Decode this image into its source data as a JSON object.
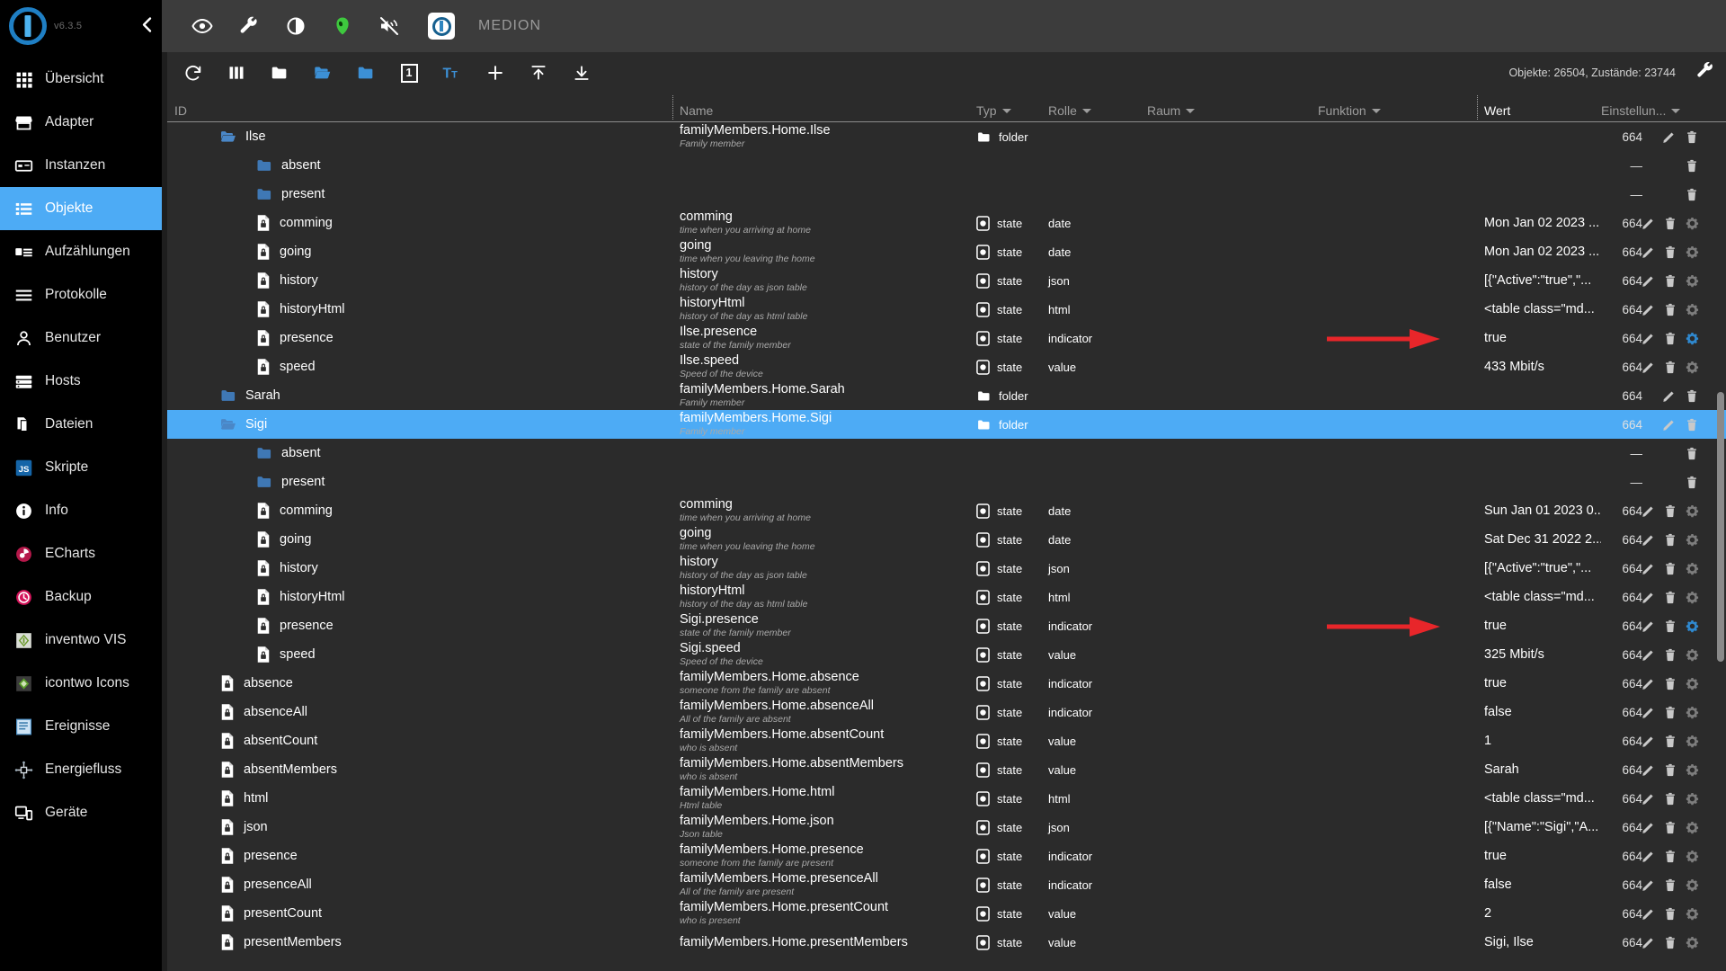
{
  "app": {
    "version": "v6.3.5",
    "host_name": "MEDION",
    "counts": "Objekte: 26504, Zustände: 23744"
  },
  "appbar": {
    "icons": [
      {
        "name": "eye-icon",
        "label": "Expertenmodus"
      },
      {
        "name": "wrench-icon",
        "label": "Einstellungen"
      },
      {
        "name": "contrast-icon",
        "label": "Design"
      },
      {
        "name": "alien-head-icon",
        "label": "Benutzer"
      },
      {
        "name": "no-sound-icon",
        "label": "Ton aus"
      }
    ]
  },
  "sidebar": {
    "collapse_icon": "chevron-left-icon",
    "items": [
      {
        "label": "Übersicht",
        "icon": "grid-icon",
        "active": false
      },
      {
        "label": "Adapter",
        "icon": "store-icon",
        "active": false
      },
      {
        "label": "Instanzen",
        "icon": "instances-icon",
        "active": false
      },
      {
        "label": "Objekte",
        "icon": "list-icon",
        "active": true
      },
      {
        "label": "Aufzählungen",
        "icon": "enum-icon",
        "active": false
      },
      {
        "label": "Protokolle",
        "icon": "log-icon",
        "active": false
      },
      {
        "label": "Benutzer",
        "icon": "user-icon",
        "active": false
      },
      {
        "label": "Hosts",
        "icon": "hosts-icon",
        "active": false
      },
      {
        "label": "Dateien",
        "icon": "files-icon",
        "active": false
      },
      {
        "label": "Skripte",
        "icon": "js-icon",
        "active": false
      },
      {
        "label": "Info",
        "icon": "info-icon",
        "active": false
      },
      {
        "label": "ECharts",
        "icon": "echarts-icon",
        "active": false
      },
      {
        "label": "Backup",
        "icon": "backup-icon",
        "active": false
      },
      {
        "label": "inventwo VIS",
        "icon": "inventwo-vis-icon",
        "active": false
      },
      {
        "label": "icontwo Icons",
        "icon": "icontwo-icons-icon",
        "active": false
      },
      {
        "label": "Ereignisse",
        "icon": "events-icon",
        "active": false
      },
      {
        "label": "Energiefluss",
        "icon": "energy-flow-icon",
        "active": false
      },
      {
        "label": "Geräte",
        "icon": "devices-icon",
        "active": false
      }
    ]
  },
  "toolbar": {
    "buttons": [
      {
        "name": "refresh-button",
        "label": "Aktualisieren"
      },
      {
        "name": "columns-button",
        "label": "Spalten"
      },
      {
        "name": "collapse-all-button",
        "label": "Alle einklappen"
      },
      {
        "name": "expand-all-button",
        "label": "Alle ausklappen"
      },
      {
        "name": "expand-folder-button",
        "label": "Ordner ausklappen"
      },
      {
        "name": "depth-button",
        "label": "1"
      },
      {
        "name": "text-size-button",
        "label": "Schriftgröße"
      },
      {
        "name": "add-object-button",
        "label": "Hinzufügen"
      },
      {
        "name": "import-button",
        "label": "Importieren"
      },
      {
        "name": "export-button",
        "label": "Exportieren"
      }
    ],
    "depth_badge": "1",
    "settings_label": "Einstellungen"
  },
  "table": {
    "columns": [
      {
        "key": "id",
        "label": "ID",
        "filter": false
      },
      {
        "key": "name",
        "label": "Name",
        "filter": false
      },
      {
        "key": "typ",
        "label": "Typ",
        "filter": true
      },
      {
        "key": "rolle",
        "label": "Rolle",
        "filter": true
      },
      {
        "key": "raum",
        "label": "Raum",
        "filter": true
      },
      {
        "key": "funktion",
        "label": "Funktion",
        "filter": true
      },
      {
        "key": "wert",
        "label": "Wert",
        "filter": false
      },
      {
        "key": "einstellungen",
        "label": "Einstellun...",
        "filter": true
      }
    ],
    "rows": [
      {
        "id": "Ilse",
        "indent": 1,
        "icon": "folder-open-icon",
        "name": "familyMembers.Home.Ilse",
        "desc": "Family member",
        "typ": "folder",
        "typ_icon": "folder-icon",
        "rolle": "",
        "wert": "",
        "perm": "664",
        "actions": [
          "edit",
          "delete"
        ],
        "selected": false
      },
      {
        "id": "absent",
        "indent": 2,
        "icon": "folder-icon",
        "name": "",
        "desc": "",
        "typ": "",
        "typ_icon": "",
        "rolle": "",
        "wert": "",
        "perm": "—",
        "actions": [
          "delete"
        ],
        "selected": false
      },
      {
        "id": "present",
        "indent": 2,
        "icon": "folder-icon",
        "name": "",
        "desc": "",
        "typ": "",
        "typ_icon": "",
        "rolle": "",
        "wert": "",
        "perm": "—",
        "actions": [
          "delete"
        ],
        "selected": false
      },
      {
        "id": "comming",
        "indent": 2,
        "icon": "state-doc-icon",
        "name": "comming",
        "desc": "time when you arriving at home",
        "typ": "state",
        "typ_icon": "state-icon",
        "rolle": "date",
        "wert": "Mon Jan 02 2023 ...",
        "perm": "664",
        "actions": [
          "edit",
          "delete",
          "settings"
        ],
        "selected": false
      },
      {
        "id": "going",
        "indent": 2,
        "icon": "state-doc-icon",
        "name": "going",
        "desc": "time when you leaving the home",
        "typ": "state",
        "typ_icon": "state-icon",
        "rolle": "date",
        "wert": "Mon Jan 02 2023 ...",
        "perm": "664",
        "actions": [
          "edit",
          "delete",
          "settings"
        ],
        "selected": false
      },
      {
        "id": "history",
        "indent": 2,
        "icon": "state-doc-icon",
        "name": "history",
        "desc": "history of the day as json table",
        "typ": "state",
        "typ_icon": "state-icon",
        "rolle": "json",
        "wert": "[{\"Active\":\"true\",\"...",
        "perm": "664",
        "actions": [
          "edit",
          "delete",
          "settings"
        ],
        "selected": false
      },
      {
        "id": "historyHtml",
        "indent": 2,
        "icon": "state-doc-icon",
        "name": "historyHtml",
        "desc": "history of the day as html table",
        "typ": "state",
        "typ_icon": "state-icon",
        "rolle": "html",
        "wert": "<table class=\"md...",
        "perm": "664",
        "actions": [
          "edit",
          "delete",
          "settings"
        ],
        "selected": false
      },
      {
        "id": "presence",
        "indent": 2,
        "icon": "state-doc-icon",
        "name": "Ilse.presence",
        "desc": "state of the family member",
        "typ": "state",
        "typ_icon": "state-icon",
        "rolle": "indicator",
        "wert": "true",
        "perm": "664",
        "actions": [
          "edit",
          "delete",
          "settings-active"
        ],
        "selected": false,
        "arrow": true
      },
      {
        "id": "speed",
        "indent": 2,
        "icon": "state-doc-icon",
        "name": "Ilse.speed",
        "desc": "Speed of the device",
        "typ": "state",
        "typ_icon": "state-icon",
        "rolle": "value",
        "wert": "433 Mbit/s",
        "perm": "664",
        "actions": [
          "edit",
          "delete",
          "settings"
        ],
        "selected": false
      },
      {
        "id": "Sarah",
        "indent": 1,
        "icon": "folder-icon",
        "name": "familyMembers.Home.Sarah",
        "desc": "Family member",
        "typ": "folder",
        "typ_icon": "folder-icon",
        "rolle": "",
        "wert": "",
        "perm": "664",
        "actions": [
          "edit",
          "delete"
        ],
        "selected": false
      },
      {
        "id": "Sigi",
        "indent": 1,
        "icon": "folder-open-icon",
        "name": "familyMembers.Home.Sigi",
        "desc": "Family member",
        "typ": "folder",
        "typ_icon": "folder-icon",
        "rolle": "",
        "wert": "",
        "perm": "664",
        "actions": [
          "edit",
          "delete"
        ],
        "selected": true
      },
      {
        "id": "absent",
        "indent": 2,
        "icon": "folder-icon",
        "name": "",
        "desc": "",
        "typ": "",
        "typ_icon": "",
        "rolle": "",
        "wert": "",
        "perm": "—",
        "actions": [
          "delete"
        ],
        "selected": false
      },
      {
        "id": "present",
        "indent": 2,
        "icon": "folder-icon",
        "name": "",
        "desc": "",
        "typ": "",
        "typ_icon": "",
        "rolle": "",
        "wert": "",
        "perm": "—",
        "actions": [
          "delete"
        ],
        "selected": false
      },
      {
        "id": "comming",
        "indent": 2,
        "icon": "state-doc-icon",
        "name": "comming",
        "desc": "time when you arriving at home",
        "typ": "state",
        "typ_icon": "state-icon",
        "rolle": "date",
        "wert": "Sun Jan 01 2023 0...",
        "perm": "664",
        "actions": [
          "edit",
          "delete",
          "settings"
        ],
        "selected": false
      },
      {
        "id": "going",
        "indent": 2,
        "icon": "state-doc-icon",
        "name": "going",
        "desc": "time when you leaving the home",
        "typ": "state",
        "typ_icon": "state-icon",
        "rolle": "date",
        "wert": "Sat Dec 31 2022 2...",
        "perm": "664",
        "actions": [
          "edit",
          "delete",
          "settings"
        ],
        "selected": false
      },
      {
        "id": "history",
        "indent": 2,
        "icon": "state-doc-icon",
        "name": "history",
        "desc": "history of the day as json table",
        "typ": "state",
        "typ_icon": "state-icon",
        "rolle": "json",
        "wert": "[{\"Active\":\"true\",\"...",
        "perm": "664",
        "actions": [
          "edit",
          "delete",
          "settings"
        ],
        "selected": false
      },
      {
        "id": "historyHtml",
        "indent": 2,
        "icon": "state-doc-icon",
        "name": "historyHtml",
        "desc": "history of the day as html table",
        "typ": "state",
        "typ_icon": "state-icon",
        "rolle": "html",
        "wert": "<table class=\"md...",
        "perm": "664",
        "actions": [
          "edit",
          "delete",
          "settings"
        ],
        "selected": false
      },
      {
        "id": "presence",
        "indent": 2,
        "icon": "state-doc-icon",
        "name": "Sigi.presence",
        "desc": "state of the family member",
        "typ": "state",
        "typ_icon": "state-icon",
        "rolle": "indicator",
        "wert": "true",
        "perm": "664",
        "actions": [
          "edit",
          "delete",
          "settings-active"
        ],
        "selected": false,
        "arrow": true
      },
      {
        "id": "speed",
        "indent": 2,
        "icon": "state-doc-icon",
        "name": "Sigi.speed",
        "desc": "Speed of the device",
        "typ": "state",
        "typ_icon": "state-icon",
        "rolle": "value",
        "wert": "325 Mbit/s",
        "perm": "664",
        "actions": [
          "edit",
          "delete",
          "settings"
        ],
        "selected": false
      },
      {
        "id": "absence",
        "indent": 1,
        "icon": "state-doc-icon",
        "name": "familyMembers.Home.absence",
        "desc": "someone from the family are absent",
        "typ": "state",
        "typ_icon": "state-icon",
        "rolle": "indicator",
        "wert": "true",
        "perm": "664",
        "actions": [
          "edit",
          "delete",
          "settings"
        ],
        "selected": false
      },
      {
        "id": "absenceAll",
        "indent": 1,
        "icon": "state-doc-icon",
        "name": "familyMembers.Home.absenceAll",
        "desc": "All of the family are absent",
        "typ": "state",
        "typ_icon": "state-icon",
        "rolle": "indicator",
        "wert": "false",
        "perm": "664",
        "actions": [
          "edit",
          "delete",
          "settings"
        ],
        "selected": false
      },
      {
        "id": "absentCount",
        "indent": 1,
        "icon": "state-doc-icon",
        "name": "familyMembers.Home.absentCount",
        "desc": "who is absent",
        "typ": "state",
        "typ_icon": "state-icon",
        "rolle": "value",
        "wert": "1",
        "perm": "664",
        "actions": [
          "edit",
          "delete",
          "settings"
        ],
        "selected": false
      },
      {
        "id": "absentMembers",
        "indent": 1,
        "icon": "state-doc-icon",
        "name": "familyMembers.Home.absentMembers",
        "desc": "who is absent",
        "typ": "state",
        "typ_icon": "state-icon",
        "rolle": "value",
        "wert": "Sarah",
        "perm": "664",
        "actions": [
          "edit",
          "delete",
          "settings"
        ],
        "selected": false
      },
      {
        "id": "html",
        "indent": 1,
        "icon": "state-doc-icon",
        "name": "familyMembers.Home.html",
        "desc": "Html table",
        "typ": "state",
        "typ_icon": "state-icon",
        "rolle": "html",
        "wert": "<table class=\"md...",
        "perm": "664",
        "actions": [
          "edit",
          "delete",
          "settings"
        ],
        "selected": false
      },
      {
        "id": "json",
        "indent": 1,
        "icon": "state-doc-icon",
        "name": "familyMembers.Home.json",
        "desc": "Json table",
        "typ": "state",
        "typ_icon": "state-icon",
        "rolle": "json",
        "wert": "[{\"Name\":\"Sigi\",\"A...",
        "perm": "664",
        "actions": [
          "edit",
          "delete",
          "settings"
        ],
        "selected": false
      },
      {
        "id": "presence",
        "indent": 1,
        "icon": "state-doc-icon",
        "name": "familyMembers.Home.presence",
        "desc": "someone from the family are present",
        "typ": "state",
        "typ_icon": "state-icon",
        "rolle": "indicator",
        "wert": "true",
        "perm": "664",
        "actions": [
          "edit",
          "delete",
          "settings"
        ],
        "selected": false
      },
      {
        "id": "presenceAll",
        "indent": 1,
        "icon": "state-doc-icon",
        "name": "familyMembers.Home.presenceAll",
        "desc": "All of the family are present",
        "typ": "state",
        "typ_icon": "state-icon",
        "rolle": "indicator",
        "wert": "false",
        "perm": "664",
        "actions": [
          "edit",
          "delete",
          "settings"
        ],
        "selected": false
      },
      {
        "id": "presentCount",
        "indent": 1,
        "icon": "state-doc-icon",
        "name": "familyMembers.Home.presentCount",
        "desc": "who is present",
        "typ": "state",
        "typ_icon": "state-icon",
        "rolle": "value",
        "wert": "2",
        "perm": "664",
        "actions": [
          "edit",
          "delete",
          "settings"
        ],
        "selected": false
      },
      {
        "id": "presentMembers",
        "indent": 1,
        "icon": "state-doc-icon",
        "name": "familyMembers.Home.presentMembers",
        "desc": "",
        "typ": "state",
        "typ_icon": "state-icon",
        "rolle": "value",
        "wert": "Sigi, Ilse",
        "perm": "664",
        "actions": [
          "edit",
          "delete",
          "settings"
        ],
        "selected": false
      }
    ]
  },
  "colors": {
    "accent": "#4dabf5",
    "folder": "#3f78b5",
    "folder_light": "#4a87c7",
    "arrow": "#e8262a",
    "sidebar_bg": "#000000",
    "panel_bg": "#2b2b2b",
    "appbar_bg": "#3c3c3c"
  }
}
